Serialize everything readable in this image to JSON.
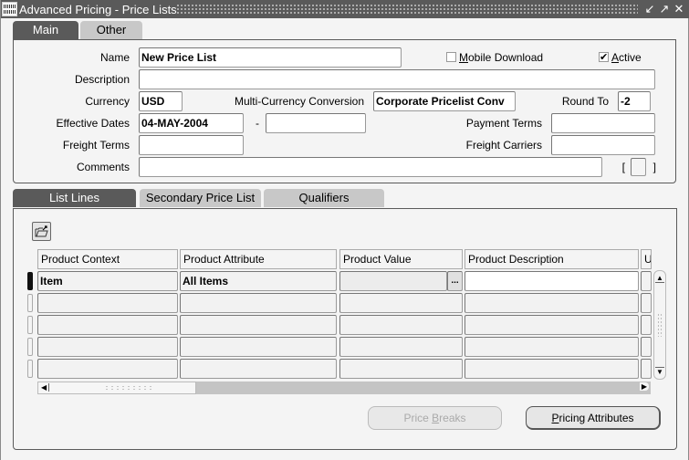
{
  "window": {
    "title": "Advanced Pricing - Price Lists",
    "controls": {
      "minimize": "↙",
      "maximize": "↗",
      "close": "✕"
    }
  },
  "top_tabs": [
    {
      "label": "Main",
      "active": true
    },
    {
      "label": "Other",
      "active": false
    }
  ],
  "header": {
    "name_label": "Name",
    "name_value": "New Price List",
    "mobile_download_label": "Mobile Download",
    "mobile_download_mnemonic": "M",
    "mobile_download_rest": "obile Download",
    "mobile_download_checked": false,
    "active_label": "Active",
    "active_mnemonic": "A",
    "active_rest": "ctive",
    "active_checked": true,
    "description_label": "Description",
    "description_value": "",
    "currency_label": "Currency",
    "currency_value": "USD",
    "multi_currency_label": "Multi-Currency Conversion",
    "multi_currency_value": "Corporate Pricelist Conv",
    "round_to_label": "Round To",
    "round_to_value": "-2",
    "effective_dates_label": "Effective Dates",
    "effective_from": "04-MAY-2004",
    "date_separator": "-",
    "effective_to": "",
    "payment_terms_label": "Payment Terms",
    "payment_terms_value": "",
    "freight_terms_label": "Freight Terms",
    "freight_terms_value": "",
    "freight_carriers_label": "Freight Carriers",
    "freight_carriers_value": "",
    "comments_label": "Comments",
    "comments_value": "",
    "flex_open": "[",
    "flex_close": "]"
  },
  "lower_tabs": [
    {
      "label": "List Lines",
      "active": true
    },
    {
      "label": "Secondary Price List",
      "active": false
    },
    {
      "label": "Qualifiers",
      "active": false
    }
  ],
  "list_lines": {
    "toolbar_icon": "folder-open-icon",
    "columns": [
      "Product Context",
      "Product Attribute",
      "Product Value",
      "Product Description",
      "U"
    ],
    "rows": [
      {
        "context": "Item",
        "attribute": "All Items",
        "value": "",
        "description": "",
        "current": true
      },
      {
        "context": "",
        "attribute": "",
        "value": "",
        "description": "",
        "current": false
      },
      {
        "context": "",
        "attribute": "",
        "value": "",
        "description": "",
        "current": false
      },
      {
        "context": "",
        "attribute": "",
        "value": "",
        "description": "",
        "current": false
      },
      {
        "context": "",
        "attribute": "",
        "value": "",
        "description": "",
        "current": false
      }
    ],
    "lov_button": "..."
  },
  "buttons": {
    "price_breaks_pre": "Price ",
    "price_breaks_mnemonic": "B",
    "price_breaks_post": "reaks",
    "price_breaks_enabled": false,
    "pricing_attributes_mnemonic": "P",
    "pricing_attributes_post": "ricing Attributes",
    "pricing_attributes_enabled": true
  }
}
